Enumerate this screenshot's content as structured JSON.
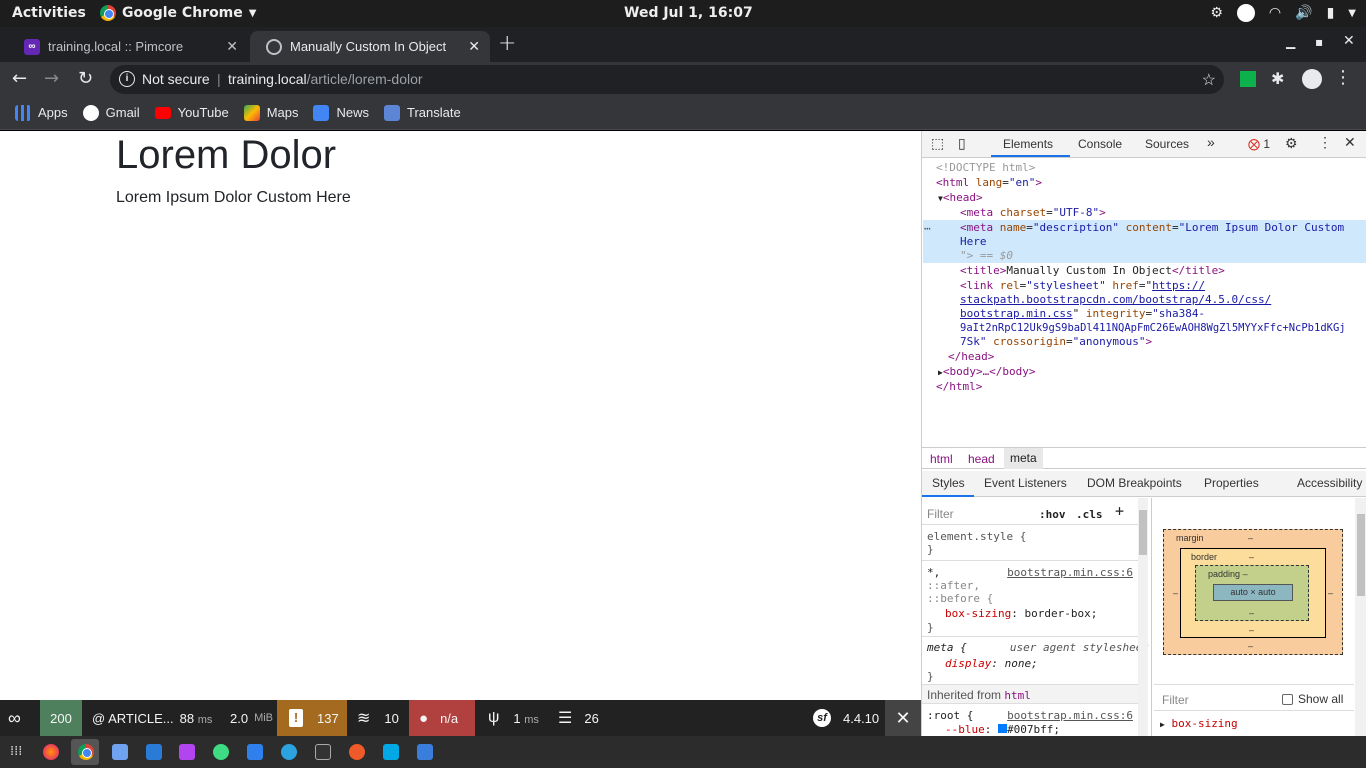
{
  "topbar": {
    "activities": "Activities",
    "app_name": "Google Chrome",
    "clock": "Wed Jul  1, 16:07"
  },
  "tabs": [
    {
      "title": "training.local :: Pimcore"
    },
    {
      "title": "Manually Custom In Object"
    }
  ],
  "omnibox": {
    "security_label": "Not secure",
    "host": "training.local",
    "path": "/article/lorem-dolor"
  },
  "bookmarks": [
    {
      "label": "Apps"
    },
    {
      "label": "Gmail"
    },
    {
      "label": "YouTube"
    },
    {
      "label": "Maps"
    },
    {
      "label": "News"
    },
    {
      "label": "Translate"
    }
  ],
  "page": {
    "heading": "Lorem Dolor",
    "body": "Lorem Ipsum Dolor Custom Here"
  },
  "devtools": {
    "tabs": [
      "Elements",
      "Console",
      "Sources"
    ],
    "more": "»",
    "error_count": "1",
    "dom": {
      "doctype": "<!DOCTYPE html>",
      "html_open": "<html",
      "lang_attr": "lang",
      "lang_val": "\"en\"",
      "head_open": "<head>",
      "meta1_tag": "<meta",
      "meta1_attr": "charset",
      "meta1_val": "\"UTF-8\"",
      "meta2_tag": "<meta",
      "meta2_attr1": "name",
      "meta2_val1": "\"description\"",
      "meta2_attr2": "content",
      "meta2_val2": "\"Lorem Ipsum Dolor Custom",
      "meta2_val2b": "Here",
      "meta2_end": "\"> == $0",
      "title_open": "<title>",
      "title_text": "Manually Custom In Object",
      "title_close": "</title>",
      "link_tag": "<link",
      "link_rel_attr": "rel",
      "link_rel_val": "\"stylesheet\"",
      "link_href_attr": "href",
      "link_href_1": "https://",
      "link_href_2": "stackpath.bootstrapcdn.com/bootstrap/4.5.0/css/",
      "link_href_3": "bootstrap.min.css",
      "link_int_attr": "integrity",
      "link_int_val1": "\"sha384-",
      "link_int_val2": "9aIt2nRpC12Uk9gS9baDl411NQApFmC26EwAOH8WgZl5MYYxFfc+NcPb1dKGj",
      "link_int_val3": "7Sk\"",
      "link_co_attr": "crossorigin",
      "link_co_val": "\"anonymous\"",
      "head_close": "</head>",
      "body_collapsed": "<body>…</body>",
      "html_close": "</html>"
    },
    "breadcrumbs": [
      "html",
      "head",
      "meta"
    ],
    "subtabs": [
      "Styles",
      "Event Listeners",
      "DOM Breakpoints",
      "Properties",
      "Accessibility"
    ],
    "styles": {
      "filter_placeholder": "Filter",
      "hov": ":hov",
      "cls": ".cls",
      "element_style": "element.style {",
      "close_brace": "}",
      "rule1_sel1": "*,",
      "rule1_sel2": "::after,",
      "rule1_sel3": "::before {",
      "rule1_src": "bootstrap.min.css:6",
      "rule1_prop": "box-sizing",
      "rule1_val": ": border-box;",
      "rule2_sel": "meta {",
      "rule2_src": "user agent stylesheet",
      "rule2_prop": "display",
      "rule2_val": ": none;",
      "inherited_label": "Inherited from",
      "inherited_tag": "html",
      "root_sel": ":root {",
      "root_src": "bootstrap.min.css:6",
      "root_prop": "--blue",
      "root_val": "#007bff;"
    },
    "boxmodel": {
      "margin": "margin",
      "border": "border",
      "padding": "padding",
      "content": "auto × auto",
      "dash": "–",
      "filter_placeholder": "Filter",
      "show_all": "Show all",
      "computed_prop": "box-sizing"
    }
  },
  "symfony": {
    "status": "200",
    "route": "@ ARTICLE...",
    "time": "88",
    "time_unit": "ms",
    "memory": "2.0",
    "memory_unit": "MiB",
    "logs": "137",
    "cache": "10",
    "user": "n/a",
    "twig_time": "1",
    "twig_unit": "ms",
    "db": "26",
    "version": "4.4.10",
    "status_color": "#4f805d",
    "logs_color": "#a46a1f",
    "user_color": "#b0413e"
  }
}
